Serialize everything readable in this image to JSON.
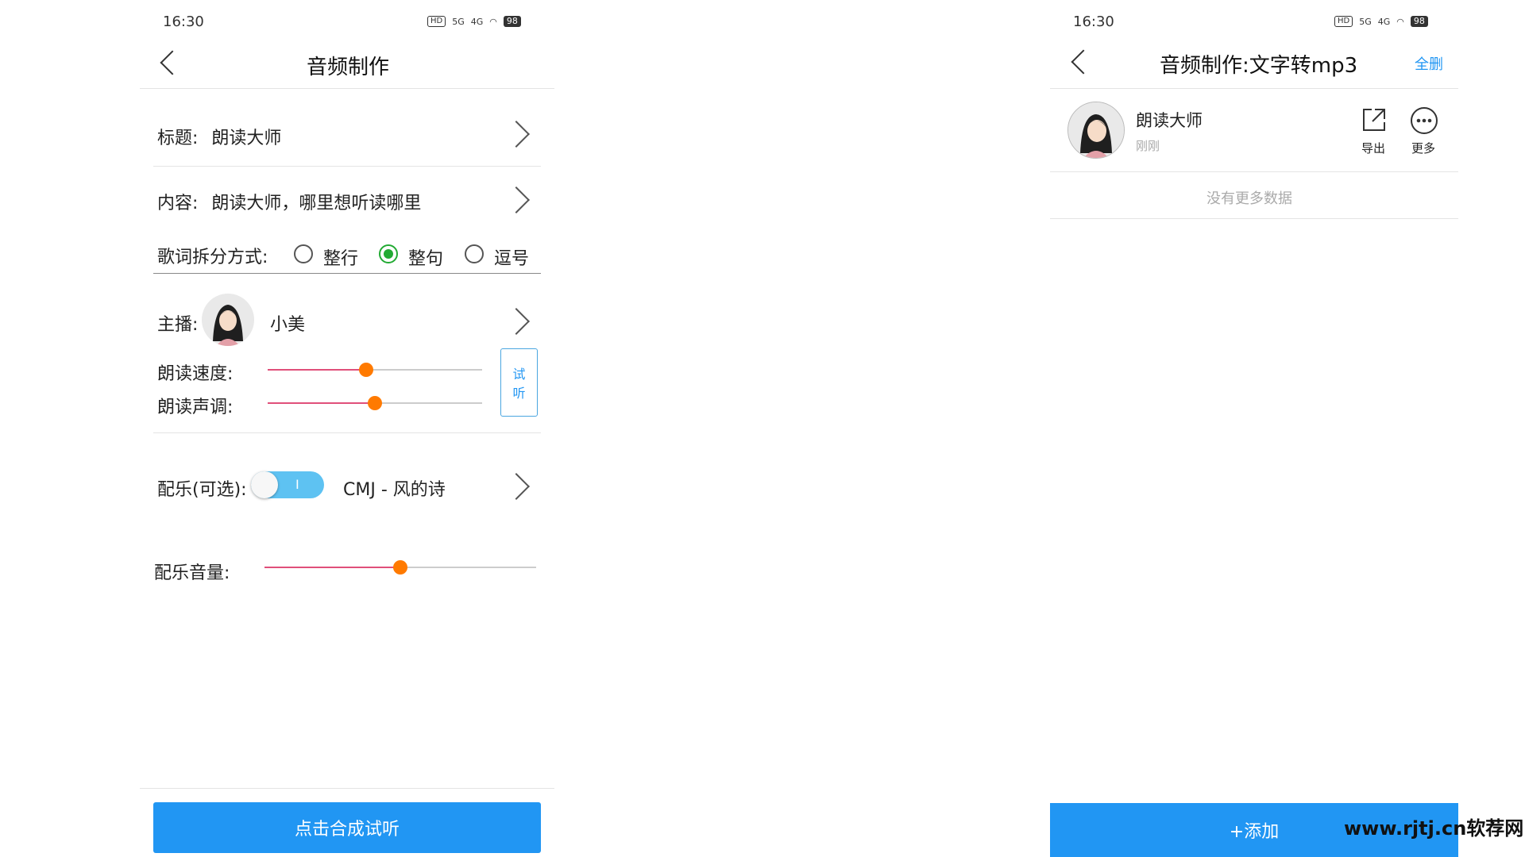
{
  "left": {
    "status": {
      "time": "16:30",
      "hd": "HD",
      "net1": "5G",
      "net2": "4G",
      "battery": "98"
    },
    "header": {
      "title": "音频制作"
    },
    "title_row": {
      "label": "标题:",
      "value": "朗读大师"
    },
    "content_row": {
      "label": "内容:",
      "value": "朗读大师，哪里想听读哪里"
    },
    "split": {
      "label": "歌词拆分方式:",
      "options": [
        {
          "label": "整行",
          "selected": false
        },
        {
          "label": "整句",
          "selected": true
        },
        {
          "label": "逗号",
          "selected": false
        }
      ]
    },
    "anchor": {
      "label": "主播:",
      "name": "小美"
    },
    "speed": {
      "label": "朗读速度:",
      "value": 0.46
    },
    "pitch": {
      "label": "朗读声调:",
      "value": 0.5
    },
    "preview_button": {
      "line1": "试",
      "line2": "听"
    },
    "music": {
      "label": "配乐(可选):",
      "toggle_text": "I",
      "toggle_on": true,
      "track": "CMJ - 风的诗"
    },
    "music_volume": {
      "label": "配乐音量:",
      "value": 0.5
    },
    "submit": {
      "label": "点击合成试听"
    },
    "accent_color": "#2196f3"
  },
  "right": {
    "status": {
      "time": "16:30",
      "hd": "HD",
      "net1": "5G",
      "net2": "4G",
      "battery": "98"
    },
    "header": {
      "title": "音频制作:文字转mp3",
      "action": "全删"
    },
    "item": {
      "title": "朗读大师",
      "time": "刚刚",
      "export_label": "导出",
      "more_label": "更多"
    },
    "empty_text": "没有更多数据",
    "add_button": {
      "label": "+添加"
    }
  },
  "watermark": {
    "text": "www.rjtj.cn软荐网"
  }
}
